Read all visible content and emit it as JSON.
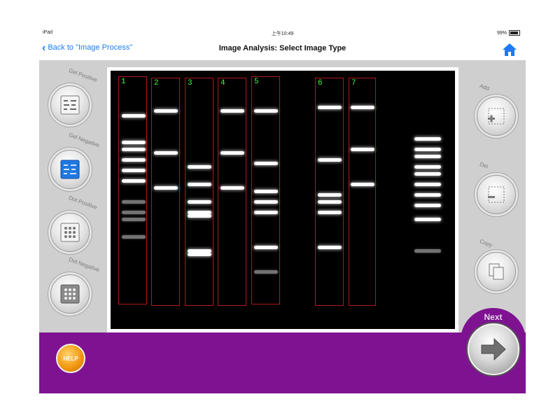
{
  "status": {
    "device": "iPad",
    "time": "上午10:49",
    "battery": "99%"
  },
  "nav": {
    "back_label": "Back to \"Image Process\"",
    "title": "Image Analysis: Select Image Type"
  },
  "left_buttons": [
    {
      "label": "Gel Positive",
      "icon": "gel-positive-icon"
    },
    {
      "label": "Gel Negative",
      "icon": "gel-negative-icon"
    },
    {
      "label": "Dot Positive",
      "icon": "dot-positive-icon"
    },
    {
      "label": "Dot Negative",
      "icon": "dot-negative-icon"
    }
  ],
  "right_buttons": [
    {
      "label": "Add",
      "icon": "add-lane-icon"
    },
    {
      "label": "Del",
      "icon": "delete-lane-icon"
    },
    {
      "label": "Copy",
      "icon": "copy-icon"
    }
  ],
  "lanes": [
    "1",
    "2",
    "3",
    "4",
    "5",
    "6",
    "7"
  ],
  "bottom": {
    "help_label": "HELP",
    "next_label": "Next"
  },
  "colors": {
    "accent": "#1a7cf5",
    "bottom_bar": "#7e1291",
    "lane_box": "#b01818",
    "lane_number": "#39ff39",
    "help": "#f39a12"
  }
}
